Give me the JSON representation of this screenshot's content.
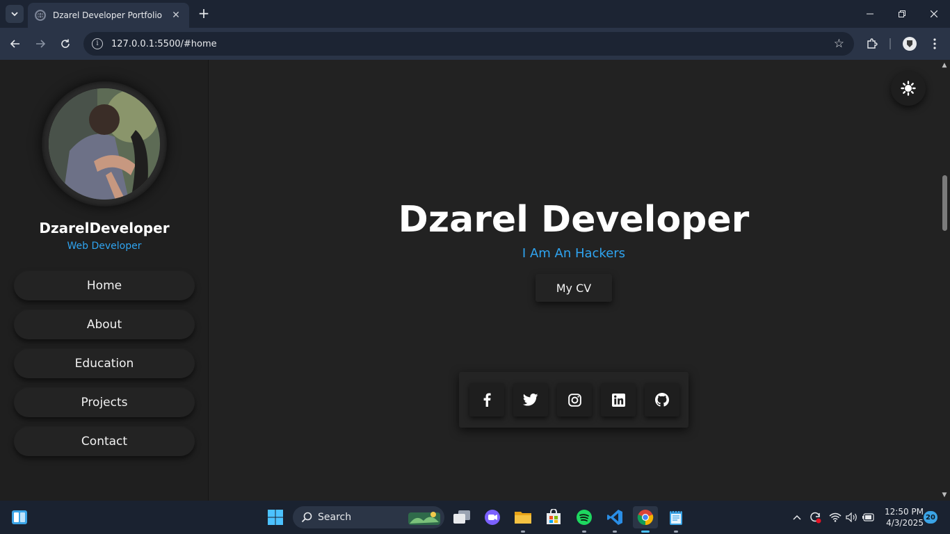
{
  "browser": {
    "tab_title": "Dzarel Developer Portfolio",
    "url": "127.0.0.1:5500/#home"
  },
  "sidebar": {
    "brand": "DzarelDeveloper",
    "role": "Web Developer",
    "nav": [
      {
        "label": "Home"
      },
      {
        "label": "About"
      },
      {
        "label": "Education"
      },
      {
        "label": "Projects"
      },
      {
        "label": "Contact"
      }
    ]
  },
  "hero": {
    "title": "Dzarel Developer",
    "subtitle": "I Am An Hackers",
    "cv_button": "My CV"
  },
  "social": [
    "facebook-icon",
    "twitter-icon",
    "instagram-icon",
    "linkedin-icon",
    "github-icon"
  ],
  "taskbar": {
    "search_placeholder": "Search",
    "time": "12:50 PM",
    "date": "4/3/2025",
    "notifications": "20"
  },
  "colors": {
    "accent": "#2fa4f0",
    "background": "#222222",
    "sidebar": "#1f1f1f"
  }
}
